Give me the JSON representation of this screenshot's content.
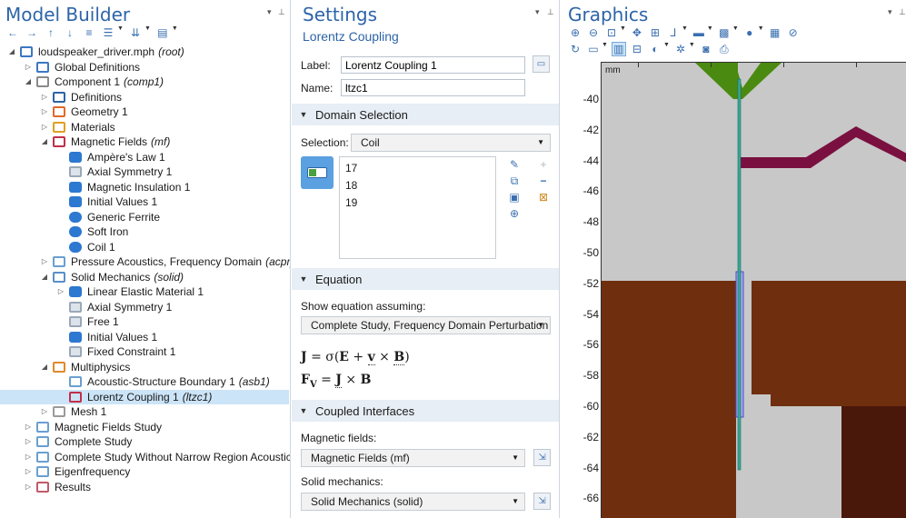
{
  "model_builder": {
    "title": "Model Builder",
    "tree": [
      {
        "level": 0,
        "expander": "expanded",
        "icon": "model-file-icon",
        "color": "#3a78c2",
        "label": "loudspeaker_driver.mph",
        "tag": "(root)"
      },
      {
        "level": 1,
        "expander": "collapsed",
        "icon": "globe-icon",
        "color": "#3a78c2",
        "label": "Global Definitions",
        "tag": ""
      },
      {
        "level": 1,
        "expander": "expanded",
        "icon": "component-icon",
        "color": "#8a8a8a",
        "label": "Component 1",
        "tag": "(comp1)"
      },
      {
        "level": 2,
        "expander": "collapsed",
        "icon": "definitions-icon",
        "color": "#2d64a8",
        "label": "Definitions",
        "tag": ""
      },
      {
        "level": 2,
        "expander": "collapsed",
        "icon": "geometry-icon",
        "color": "#e06a2a",
        "label": "Geometry 1",
        "tag": ""
      },
      {
        "level": 2,
        "expander": "collapsed",
        "icon": "materials-icon",
        "color": "#e0a020",
        "label": "Materials",
        "tag": ""
      },
      {
        "level": 2,
        "expander": "expanded",
        "icon": "magnetic-fields-icon",
        "color": "#c0304a",
        "label": "Magnetic Fields",
        "tag": "(mf)"
      },
      {
        "level": 3,
        "expander": "",
        "icon": "feature-icon",
        "color": "#2d78d0",
        "label": "Ampère's Law 1",
        "tag": ""
      },
      {
        "level": 3,
        "expander": "",
        "icon": "boundary-icon",
        "color": "#9aa8b8",
        "label": "Axial Symmetry 1",
        "tag": ""
      },
      {
        "level": 3,
        "expander": "",
        "icon": "feature-icon",
        "color": "#2d78d0",
        "label": "Magnetic Insulation 1",
        "tag": ""
      },
      {
        "level": 3,
        "expander": "",
        "icon": "feature-icon",
        "color": "#2d78d0",
        "label": "Initial Values 1",
        "tag": ""
      },
      {
        "level": 3,
        "expander": "",
        "icon": "domain-icon",
        "color": "#2d78d0",
        "label": "Generic Ferrite",
        "tag": ""
      },
      {
        "level": 3,
        "expander": "",
        "icon": "domain-icon",
        "color": "#2d78d0",
        "label": "Soft Iron",
        "tag": ""
      },
      {
        "level": 3,
        "expander": "",
        "icon": "domain-icon",
        "color": "#2d78d0",
        "label": "Coil 1",
        "tag": ""
      },
      {
        "level": 2,
        "expander": "collapsed",
        "icon": "acoustics-icon",
        "color": "#6a9fd0",
        "label": "Pressure Acoustics, Frequency Domain",
        "tag": "(acpr)"
      },
      {
        "level": 2,
        "expander": "expanded",
        "icon": "solid-mechanics-icon",
        "color": "#5a8fc8",
        "label": "Solid Mechanics",
        "tag": "(solid)"
      },
      {
        "level": 3,
        "expander": "collapsed",
        "icon": "feature-icon",
        "color": "#2d78d0",
        "label": "Linear Elastic Material 1",
        "tag": ""
      },
      {
        "level": 3,
        "expander": "",
        "icon": "boundary-icon",
        "color": "#9aa8b8",
        "label": "Axial Symmetry 1",
        "tag": ""
      },
      {
        "level": 3,
        "expander": "",
        "icon": "boundary-icon",
        "color": "#9aa8b8",
        "label": "Free 1",
        "tag": ""
      },
      {
        "level": 3,
        "expander": "",
        "icon": "feature-icon",
        "color": "#2d78d0",
        "label": "Initial Values 1",
        "tag": ""
      },
      {
        "level": 3,
        "expander": "",
        "icon": "boundary-icon",
        "color": "#9aa8b8",
        "label": "Fixed Constraint 1",
        "tag": ""
      },
      {
        "level": 2,
        "expander": "expanded",
        "icon": "multiphysics-icon",
        "color": "#e08a2a",
        "label": "Multiphysics",
        "tag": ""
      },
      {
        "level": 3,
        "expander": "",
        "icon": "acoustic-structure-icon",
        "color": "#6a9fd0",
        "label": "Acoustic-Structure Boundary 1",
        "tag": "(asb1)"
      },
      {
        "level": 3,
        "expander": "",
        "icon": "lorentz-coupling-icon",
        "color": "#c0304a",
        "label": "Lorentz Coupling 1",
        "tag": "(ltzc1)",
        "selected": true
      },
      {
        "level": 2,
        "expander": "collapsed",
        "icon": "mesh-icon",
        "color": "#9a9a9a",
        "label": "Mesh 1",
        "tag": ""
      },
      {
        "level": 1,
        "expander": "collapsed",
        "icon": "study-icon",
        "color": "#6a9fd0",
        "label": "Magnetic Fields Study",
        "tag": ""
      },
      {
        "level": 1,
        "expander": "collapsed",
        "icon": "study-icon",
        "color": "#6a9fd0",
        "label": "Complete Study",
        "tag": ""
      },
      {
        "level": 1,
        "expander": "collapsed",
        "icon": "study-icon",
        "color": "#6a9fd0",
        "label": "Complete Study Without Narrow Region Acoustics",
        "tag": ""
      },
      {
        "level": 1,
        "expander": "collapsed",
        "icon": "study-icon",
        "color": "#6a9fd0",
        "label": "Eigenfrequency",
        "tag": ""
      },
      {
        "level": 1,
        "expander": "collapsed",
        "icon": "results-icon",
        "color": "#c05a6a",
        "label": "Results",
        "tag": ""
      }
    ]
  },
  "settings": {
    "title": "Settings",
    "subtitle": "Lorentz Coupling",
    "label_caption": "Label:",
    "label_value": "Lorentz Coupling 1",
    "name_caption": "Name:",
    "name_value": "ltzc1",
    "domain_section": "Domain Selection",
    "selection_caption": "Selection:",
    "selection_value": "Coil",
    "domains": [
      "17",
      "18",
      "19"
    ],
    "equation_section": "Equation",
    "show_eq_caption": "Show equation assuming:",
    "study_value": "Complete Study, Frequency Domain Perturbation",
    "coupled_section": "Coupled Interfaces",
    "magnetic_caption": "Magnetic fields:",
    "magnetic_value": "Magnetic Fields (mf)",
    "solid_caption": "Solid mechanics:",
    "solid_value": "Solid Mechanics (solid)"
  },
  "graphics": {
    "title": "Graphics",
    "unit": "mm",
    "y_ticks": [
      "-40",
      "-42",
      "-44",
      "-46",
      "-48",
      "-50",
      "-52",
      "-54",
      "-56",
      "-58",
      "-60",
      "-62",
      "-64",
      "-66"
    ],
    "colors": {
      "air": "#c8c8c8",
      "iron": "#6f2f0f",
      "magnet": "#4a180a",
      "cone": "#4a8a10",
      "surround": "#7a1040",
      "coil": "#a8a8f0",
      "former": "#3aa89a"
    }
  }
}
